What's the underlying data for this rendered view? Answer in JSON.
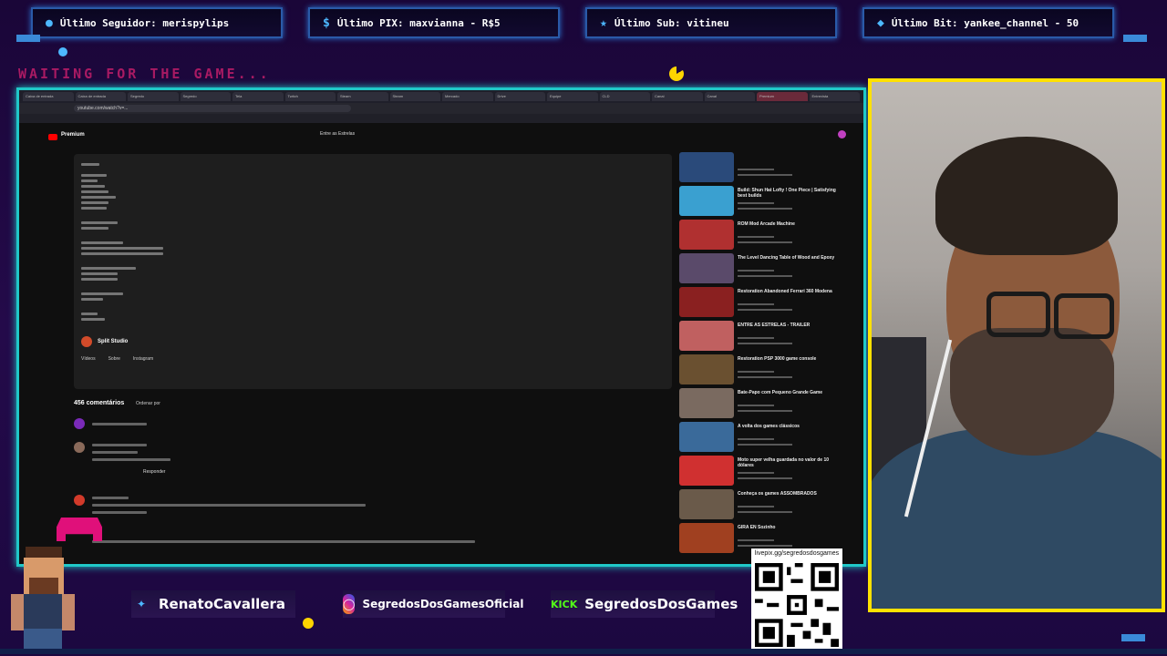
{
  "alerts": [
    {
      "icon": "user-icon",
      "text": "Último Seguidor: merispylips"
    },
    {
      "icon": "dollar-icon",
      "text": "Último PIX: maxvianna - R$5"
    },
    {
      "icon": "star-icon",
      "text": "Último Sub: vitineu"
    },
    {
      "icon": "diamond-icon",
      "text": "Último Bit: yankee_channel - 50"
    }
  ],
  "waiting_text": "WAITING FOR THE GAME...",
  "browser": {
    "tabs": [
      "Caixa de entrada",
      "Caixa de entrada",
      "Segredo",
      "Segredo",
      "Tela",
      "Twitch",
      "Steam",
      "Steam",
      "Mercado",
      "Drive",
      "Equipe",
      "CLD",
      "Canal",
      "Canal",
      "Premium",
      "Entrevista"
    ],
    "url": "youtube.com/watch?v=...",
    "youtube": {
      "premium_label": "Premium",
      "search_text": "Entre as Estrelas",
      "channel_name": "Split Studio",
      "channel_buttons": [
        "Vídeos",
        "Sobre",
        "Instagram"
      ],
      "comments_count": "456 comentários",
      "order_label": "Ordenar por",
      "reply_label": "Responder"
    },
    "sidebar_videos": [
      {
        "title": ""
      },
      {
        "title": "Build: Shun Hat Lofty ! One Piece | Satisfying best builds"
      },
      {
        "title": "ROM Mod Arcade Machine"
      },
      {
        "title": "The Level Dancing Table of Wood and Epoxy"
      },
      {
        "title": "Restoration Abandoned Ferrari 360 Modena"
      },
      {
        "title": "ENTRE AS ESTRELAS - TRAILER"
      },
      {
        "title": "Restoration PSP 3000 game console"
      },
      {
        "title": "Bate-Papo com Pequeno Grande Game"
      },
      {
        "title": "A volta dos games clássicos"
      },
      {
        "title": "Moto super velha guardada no valor de 10 dólares"
      },
      {
        "title": "Conheça os games ASSOMBRADOS"
      },
      {
        "title": "GIRA EN Sozinho"
      }
    ]
  },
  "socials": {
    "twitter": "RenatoCavallera",
    "instagram": "SegredosDosGamesOficial",
    "kick_label": "KICK",
    "kick": "SegredosDosGames"
  },
  "qr_url": "livepix.gg/segredosdosgames",
  "colors": {
    "frame": "#20c8c8",
    "cam_border": "#ffe100",
    "alert_border": "#2a5aa8",
    "waiting": "#c21e6a"
  }
}
